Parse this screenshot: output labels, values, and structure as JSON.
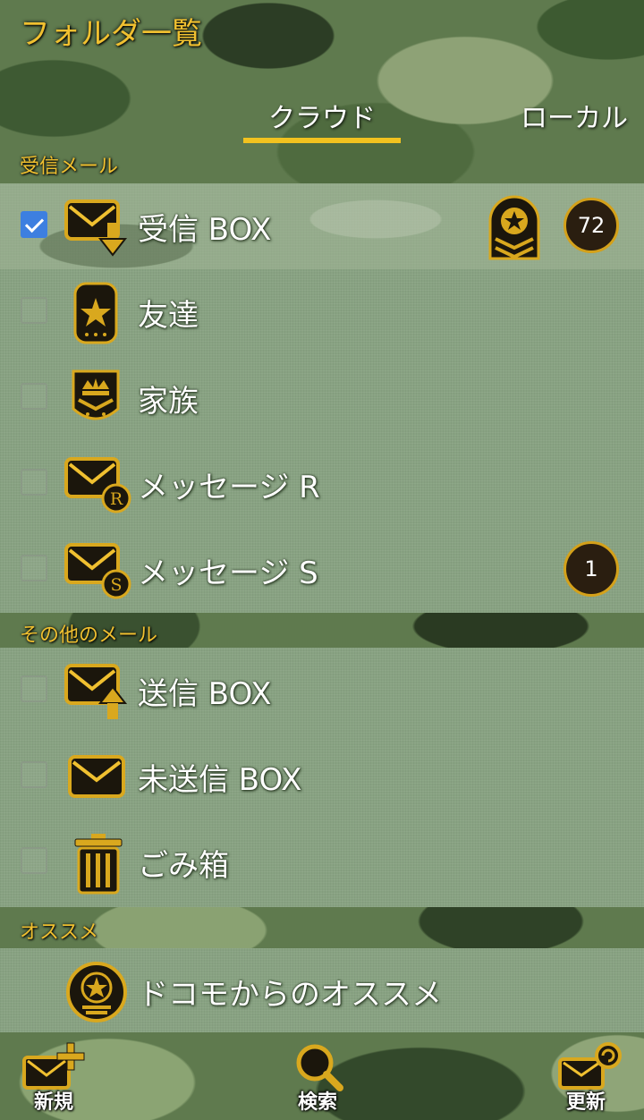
{
  "header": {
    "title": "フォルダ一覧"
  },
  "tabs": [
    {
      "label": "クラウド"
    },
    {
      "label": "ローカル"
    }
  ],
  "sections": {
    "inbox": {
      "label": "受信メール",
      "items": [
        {
          "label": "受信 BOX",
          "checked": true,
          "badge": "72",
          "icon": "mail-download-icon"
        },
        {
          "label": "友達",
          "checked": false,
          "icon": "star-shield-icon"
        },
        {
          "label": "家族",
          "checked": false,
          "icon": "crown-shield-icon"
        },
        {
          "label": "メッセージ R",
          "checked": false,
          "icon": "mail-r-icon"
        },
        {
          "label": "メッセージ S",
          "checked": false,
          "badge": "1",
          "icon": "mail-s-icon"
        }
      ]
    },
    "other": {
      "label": "その他のメール",
      "items": [
        {
          "label": "送信 BOX",
          "checked": false,
          "icon": "mail-upload-icon"
        },
        {
          "label": "未送信 BOX",
          "checked": false,
          "icon": "mail-icon"
        },
        {
          "label": "ごみ箱",
          "checked": false,
          "icon": "trash-icon"
        }
      ]
    },
    "recommend": {
      "label": "オススメ",
      "items": [
        {
          "label": "ドコモからのオススメ",
          "icon": "star-medal-icon"
        }
      ]
    }
  },
  "bottom_bar": {
    "new_label": "新規",
    "search_label": "検索",
    "refresh_label": "更新"
  },
  "colors": {
    "accent": "#f0c030",
    "tab_underline": "#f2c21f",
    "checkbox_checked": "#3d7fe0"
  }
}
